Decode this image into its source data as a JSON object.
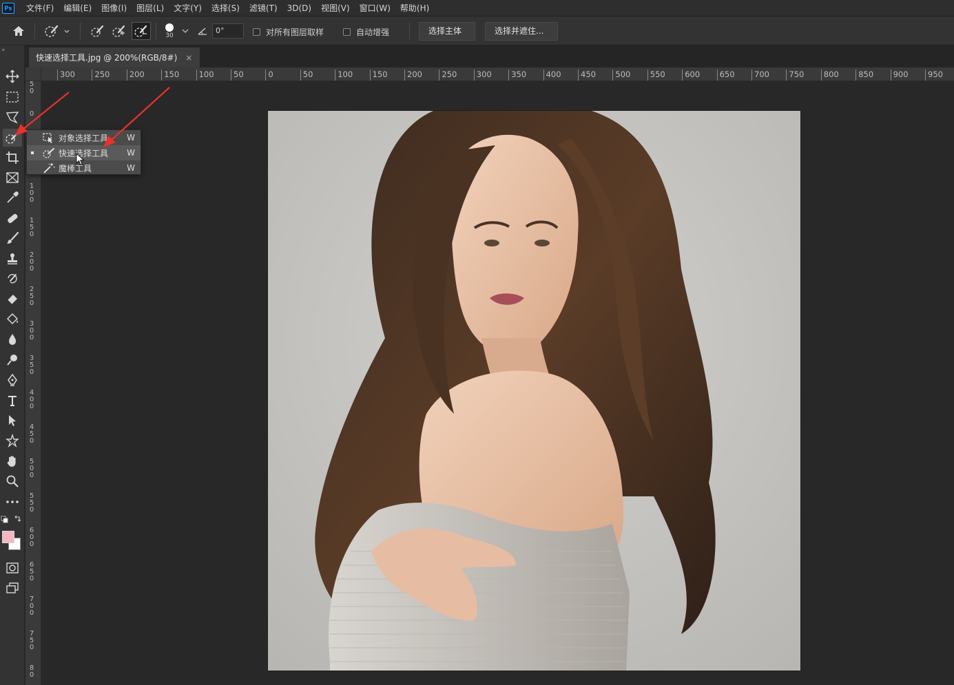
{
  "menubar": {
    "logo": "Ps",
    "items": [
      "文件(F)",
      "编辑(E)",
      "图像(I)",
      "图层(L)",
      "文字(Y)",
      "选择(S)",
      "滤镜(T)",
      "3D(D)",
      "视图(V)",
      "窗口(W)",
      "帮助(H)"
    ]
  },
  "options": {
    "brush_size": "30",
    "angle": "0°",
    "sample_all_layers": "对所有图层取样",
    "auto_enhance": "自动增强",
    "select_subject": "选择主体",
    "select_and_mask": "选择并遮住..."
  },
  "document": {
    "tab_title": "快速选择工具.jpg @ 200%(RGB/8#)",
    "close": "×"
  },
  "ruler_h": [
    "300",
    "250",
    "200",
    "150",
    "100",
    "50",
    "0",
    "50",
    "100",
    "150",
    "200",
    "250",
    "300",
    "350",
    "400",
    "450",
    "500",
    "550",
    "600",
    "650",
    "700",
    "750",
    "800",
    "850",
    "900",
    "950"
  ],
  "ruler_v": [
    "5\n0",
    "0",
    "5\n0",
    "1\n0\n0",
    "1\n5\n0",
    "2\n0\n0",
    "2\n5\n0",
    "3\n0\n0",
    "3\n5\n0",
    "4\n0\n0",
    "4\n5\n0",
    "5\n0\n0",
    "5\n5\n0",
    "6\n0\n0",
    "6\n5\n0",
    "7\n0\n0",
    "7\n5\n0",
    "8\n0"
  ],
  "flyout": {
    "items": [
      {
        "label": "对象选择工具",
        "key": "W",
        "icon": "object-selection-icon"
      },
      {
        "label": "快速选择工具",
        "key": "W",
        "icon": "quick-selection-icon"
      },
      {
        "label": "魔棒工具",
        "key": "W",
        "icon": "magic-wand-icon"
      }
    ]
  },
  "colors": {
    "foreground": "#f7b6bd",
    "background": "#ffffff",
    "annotation": "#e8322b"
  }
}
